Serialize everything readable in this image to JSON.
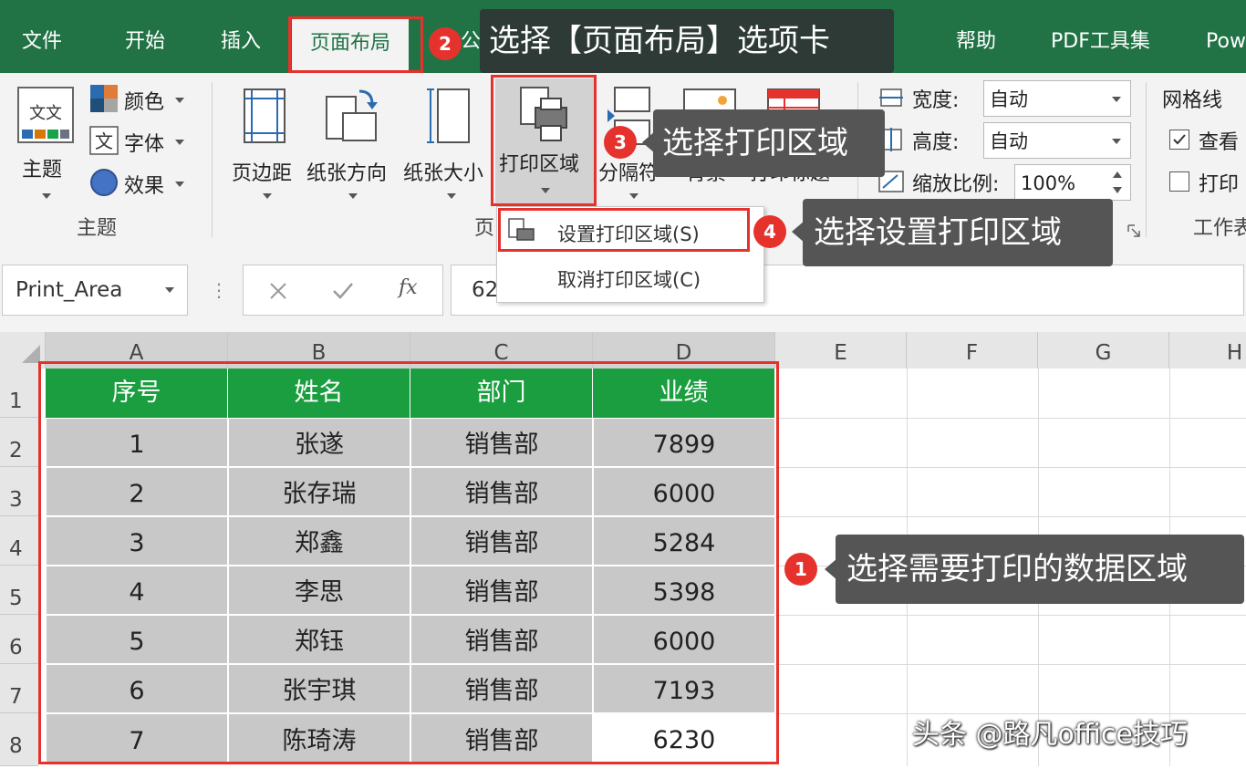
{
  "tabs": [
    {
      "label": "文件"
    },
    {
      "label": "开始"
    },
    {
      "label": "插入"
    },
    {
      "label": "页面布局"
    },
    {
      "label": "公式"
    },
    {
      "label": "帮助"
    },
    {
      "label": "PDF工具集"
    },
    {
      "label": "Pow"
    }
  ],
  "ribbon": {
    "theme_label": "主题",
    "colors_label": "颜色",
    "fonts_label": "字体",
    "effects_label": "效果",
    "group_theme": "主题",
    "margins_label": "页边距",
    "orientation_label": "纸张方向",
    "size_label": "纸张大小",
    "print_area_label": "打印区域",
    "breaks_label": "分隔符",
    "background_label": "背景",
    "print_titles_label": "打印标题",
    "group_page_setup": "页",
    "width_label": "宽度:",
    "width_value": "自动",
    "height_label": "高度:",
    "height_value": "自动",
    "scale_label": "缩放比例:",
    "scale_value": "100%",
    "gridlines_label": "网格线",
    "view_label": "查看",
    "print_label": "打印",
    "group_sheet": "工作表"
  },
  "dropdown": {
    "set_print_area": "设置打印区域(S)",
    "clear_print_area": "取消打印区域(C)"
  },
  "formula_bar": {
    "name_box": "Print_Area",
    "fx": "fx",
    "value": "62"
  },
  "columns": [
    "A",
    "B",
    "C",
    "D",
    "E",
    "F",
    "G",
    "H"
  ],
  "rows": [
    "1",
    "2",
    "3",
    "4",
    "5",
    "6",
    "7",
    "8"
  ],
  "table": {
    "headers": [
      "序号",
      "姓名",
      "部门",
      "业绩"
    ],
    "rows": [
      [
        "1",
        "张遂",
        "销售部",
        "7899"
      ],
      [
        "2",
        "张存瑞",
        "销售部",
        "6000"
      ],
      [
        "3",
        "郑鑫",
        "销售部",
        "5284"
      ],
      [
        "4",
        "李思",
        "销售部",
        "5398"
      ],
      [
        "5",
        "郑钰",
        "销售部",
        "6000"
      ],
      [
        "6",
        "张宇琪",
        "销售部",
        "7193"
      ],
      [
        "7",
        "陈琦涛",
        "销售部",
        "6230"
      ]
    ]
  },
  "callouts": {
    "step1_num": "1",
    "step1_text": "选择需要打印的数据区域",
    "step2_num": "2",
    "step2_text": "选择【页面布局】选项卡",
    "step3_num": "3",
    "step3_text": "选择打印区域",
    "step4_num": "4",
    "step4_text": "选择设置打印区域"
  },
  "watermark": "头条 @路凡office技巧",
  "colors": {
    "excel_green": "#217346",
    "header_green": "#1a9e3f",
    "callout_red": "#e5322d",
    "cell_gray": "#c8c8c8"
  }
}
